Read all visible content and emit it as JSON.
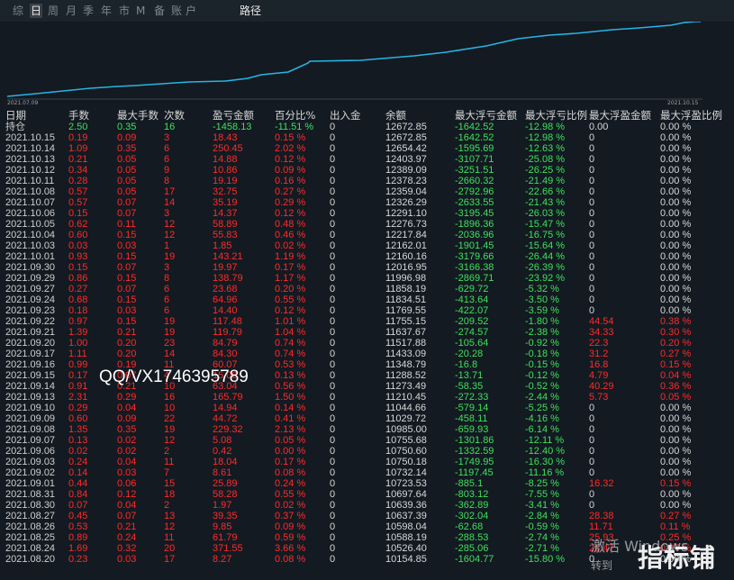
{
  "tabs": {
    "items": [
      "综",
      "日",
      "周",
      "月",
      "季",
      "年",
      "市",
      "M",
      "备",
      "账",
      "户"
    ],
    "active_index": 1,
    "path_label": "路径"
  },
  "equity_curve": {
    "start_label": "2021.07.09",
    "end_label": "2021.10.15",
    "line_color": "#26b4e6"
  },
  "table": {
    "headers": [
      "日期",
      "手数",
      "最大手数",
      "次数",
      "盈亏金额",
      "百分比%",
      "出入金",
      "余额",
      "最大浮亏金额",
      "最大浮亏比例",
      "最大浮盈金额",
      "最大浮盈比例"
    ],
    "summary": [
      "持仓",
      "2.50",
      "0.35",
      "16",
      "-1458.13",
      "-11.51 %",
      "0",
      "12672.85",
      "-1642.52",
      "-12.98 %",
      "0.00",
      "0.00 %"
    ],
    "rows": [
      [
        "2021.10.15",
        "0.19",
        "0.09",
        "3",
        "18.43",
        "0.15 %",
        "0",
        "12672.85",
        "-1642.52",
        "-12.98 %",
        "0",
        "0.00 %"
      ],
      [
        "2021.10.14",
        "1.09",
        "0.35",
        "6",
        "250.45",
        "2.02 %",
        "0",
        "12654.42",
        "-1595.69",
        "-12.63 %",
        "0",
        "0.00 %"
      ],
      [
        "2021.10.13",
        "0.21",
        "0.05",
        "6",
        "14.88",
        "0.12 %",
        "0",
        "12403.97",
        "-3107.71",
        "-25.08 %",
        "0",
        "0.00 %"
      ],
      [
        "2021.10.12",
        "0.34",
        "0.05",
        "9",
        "10.86",
        "0.09 %",
        "0",
        "12389.09",
        "-3251.51",
        "-26.25 %",
        "0",
        "0.00 %"
      ],
      [
        "2021.10.11",
        "0.28",
        "0.05",
        "8",
        "19.19",
        "0.16 %",
        "0",
        "12378.23",
        "-2660.32",
        "-21.49 %",
        "0",
        "0.00 %"
      ],
      [
        "2021.10.08",
        "0.57",
        "0.05",
        "17",
        "32.75",
        "0.27 %",
        "0",
        "12359.04",
        "-2792.96",
        "-22.66 %",
        "0",
        "0.00 %"
      ],
      [
        "2021.10.07",
        "0.57",
        "0.07",
        "14",
        "35.19",
        "0.29 %",
        "0",
        "12326.29",
        "-2633.55",
        "-21.43 %",
        "0",
        "0.00 %"
      ],
      [
        "2021.10.06",
        "0.15",
        "0.07",
        "3",
        "14.37",
        "0.12 %",
        "0",
        "12291.10",
        "-3195.45",
        "-26.03 %",
        "0",
        "0.00 %"
      ],
      [
        "2021.10.05",
        "0.62",
        "0.11",
        "12",
        "58.89",
        "0.48 %",
        "0",
        "12276.73",
        "-1896.36",
        "-15.47 %",
        "0",
        "0.00 %"
      ],
      [
        "2021.10.04",
        "0.60",
        "0.15",
        "12",
        "55.83",
        "0.46 %",
        "0",
        "12217.84",
        "-2036.96",
        "-16.75 %",
        "0",
        "0.00 %"
      ],
      [
        "2021.10.03",
        "0.03",
        "0.03",
        "1",
        "1.85",
        "0.02 %",
        "0",
        "12162.01",
        "-1901.45",
        "-15.64 %",
        "0",
        "0.00 %"
      ],
      [
        "2021.10.01",
        "0.93",
        "0.15",
        "19",
        "143.21",
        "1.19 %",
        "0",
        "12160.16",
        "-3179.66",
        "-26.44 %",
        "0",
        "0.00 %"
      ],
      [
        "2021.09.30",
        "0.15",
        "0.07",
        "3",
        "19.97",
        "0.17 %",
        "0",
        "12016.95",
        "-3166.38",
        "-26.39 %",
        "0",
        "0.00 %"
      ],
      [
        "2021.09.29",
        "0.86",
        "0.15",
        "8",
        "138.79",
        "1.17 %",
        "0",
        "11996.98",
        "-2869.71",
        "-23.92 %",
        "0",
        "0.00 %"
      ],
      [
        "2021.09.27",
        "0.27",
        "0.07",
        "6",
        "23.68",
        "0.20 %",
        "0",
        "11858.19",
        "-629.72",
        "-5.32 %",
        "0",
        "0.00 %"
      ],
      [
        "2021.09.24",
        "0.68",
        "0.15",
        "6",
        "64.96",
        "0.55 %",
        "0",
        "11834.51",
        "-413.64",
        "-3.50 %",
        "0",
        "0.00 %"
      ],
      [
        "2021.09.23",
        "0.18",
        "0.03",
        "6",
        "14.40",
        "0.12 %",
        "0",
        "11769.55",
        "-422.07",
        "-3.59 %",
        "0",
        "0.00 %"
      ],
      [
        "2021.09.22",
        "0.97",
        "0.15",
        "19",
        "117.48",
        "1.01 %",
        "0",
        "11755.15",
        "-209.52",
        "-1.80 %",
        "44.54",
        "0.38 %"
      ],
      [
        "2021.09.21",
        "1.39",
        "0.21",
        "19",
        "119.79",
        "1.04 %",
        "0",
        "11637.67",
        "-274.57",
        "-2.38 %",
        "34.33",
        "0.30 %"
      ],
      [
        "2021.09.20",
        "1.00",
        "0.20",
        "23",
        "84.79",
        "0.74 %",
        "0",
        "11517.88",
        "-105.64",
        "-0.92 %",
        "22.3",
        "0.20 %"
      ],
      [
        "2021.09.17",
        "1.11",
        "0.20",
        "14",
        "84.30",
        "0.74 %",
        "0",
        "11433.09",
        "-20.28",
        "-0.18 %",
        "31.2",
        "0.27 %"
      ],
      [
        "2021.09.16",
        "0.99",
        "0.19",
        "11",
        "60.07",
        "0.53 %",
        "0",
        "11348.79",
        "-16.8",
        "-0.15 %",
        "16.8",
        "0.15 %"
      ],
      [
        "2021.09.15",
        "0.17",
        "0.07",
        "4",
        "15.06",
        "0.13 %",
        "0",
        "11288.52",
        "-13.71",
        "-0.12 %",
        "4.79",
        "0.04 %"
      ],
      [
        "2021.09.14",
        "0.91",
        "0.21",
        "10",
        "63.04",
        "0.56 %",
        "0",
        "11273.49",
        "-58.35",
        "-0.52 %",
        "40.29",
        "0.36 %"
      ],
      [
        "2021.09.13",
        "2.31",
        "0.29",
        "16",
        "165.79",
        "1.50 %",
        "0",
        "11210.45",
        "-272.33",
        "-2.44 %",
        "5.73",
        "0.05 %"
      ],
      [
        "2021.09.10",
        "0.29",
        "0.04",
        "10",
        "14.94",
        "0.14 %",
        "0",
        "11044.66",
        "-579.14",
        "-5.25 %",
        "0",
        "0.00 %"
      ],
      [
        "2021.09.09",
        "0.60",
        "0.09",
        "22",
        "44.72",
        "0.41 %",
        "0",
        "11029.72",
        "-458.11",
        "-4.16 %",
        "0",
        "0.00 %"
      ],
      [
        "2021.09.08",
        "1.35",
        "0.35",
        "19",
        "229.32",
        "2.13 %",
        "0",
        "10985.00",
        "-659.93",
        "-6.14 %",
        "0",
        "0.00 %"
      ],
      [
        "2021.09.07",
        "0.13",
        "0.02",
        "12",
        "5.08",
        "0.05 %",
        "0",
        "10755.68",
        "-1301.86",
        "-12.11 %",
        "0",
        "0.00 %"
      ],
      [
        "2021.09.06",
        "0.02",
        "0.02",
        "2",
        "0.42",
        "0.00 %",
        "0",
        "10750.60",
        "-1332.59",
        "-12.40 %",
        "0",
        "0.00 %"
      ],
      [
        "2021.09.03",
        "0.24",
        "0.04",
        "11",
        "18.04",
        "0.17 %",
        "0",
        "10750.18",
        "-1749.95",
        "-16.30 %",
        "0",
        "0.00 %"
      ],
      [
        "2021.09.02",
        "0.14",
        "0.03",
        "7",
        "8.61",
        "0.08 %",
        "0",
        "10732.14",
        "-1197.45",
        "-11.16 %",
        "0",
        "0.00 %"
      ],
      [
        "2021.09.01",
        "0.44",
        "0.06",
        "15",
        "25.89",
        "0.24 %",
        "0",
        "10723.53",
        "-885.1",
        "-8.25 %",
        "16.32",
        "0.15 %"
      ],
      [
        "2021.08.31",
        "0.84",
        "0.12",
        "18",
        "58.28",
        "0.55 %",
        "0",
        "10697.64",
        "-803.12",
        "-7.55 %",
        "0",
        "0.00 %"
      ],
      [
        "2021.08.30",
        "0.07",
        "0.04",
        "2",
        "1.97",
        "0.02 %",
        "0",
        "10639.36",
        "-362.89",
        "-3.41 %",
        "0",
        "0.00 %"
      ],
      [
        "2021.08.27",
        "0.45",
        "0.07",
        "13",
        "39.35",
        "0.37 %",
        "0",
        "10637.39",
        "-302.04",
        "-2.84 %",
        "28.38",
        "0.27 %"
      ],
      [
        "2021.08.26",
        "0.53",
        "0.21",
        "12",
        "9.85",
        "0.09 %",
        "0",
        "10598.04",
        "-62.68",
        "-0.59 %",
        "11.71",
        "0.11 %"
      ],
      [
        "2021.08.25",
        "0.89",
        "0.24",
        "11",
        "61.79",
        "0.59 %",
        "0",
        "10588.19",
        "-288.53",
        "-2.74 %",
        "25.93",
        "0.25 %"
      ],
      [
        "2021.08.24",
        "1.69",
        "0.32",
        "20",
        "371.55",
        "3.66 %",
        "0",
        "10526.40",
        "-285.06",
        "-2.71 %",
        "28.47",
        "0.27 %"
      ],
      [
        "2021.08.20",
        "0.23",
        "0.03",
        "17",
        "8.27",
        "0.08 %",
        "0",
        "10154.85",
        "-1604.77",
        "-15.80 %",
        "0",
        "0.00 %"
      ]
    ]
  },
  "overlay": {
    "watermark": "QQ/VX1746395789",
    "windows_line1": "激活 Windows",
    "windows_line2": "转到",
    "logo_text": "指标铺"
  }
}
